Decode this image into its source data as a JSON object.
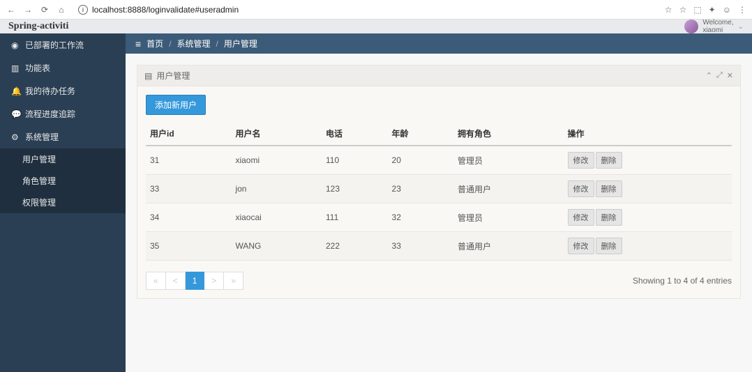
{
  "browser": {
    "url": "localhost:8888/loginvalidate#useradmin"
  },
  "header": {
    "brand": "Spring-activiti",
    "welcome": "Welcome,",
    "username": "xiaomi"
  },
  "sidebar": {
    "items": [
      {
        "icon": "dashboard",
        "label": "已部署的工作流"
      },
      {
        "icon": "chart",
        "label": "功能表"
      },
      {
        "icon": "bell",
        "label": "我的待办任务"
      },
      {
        "icon": "comment",
        "label": "流程进度追踪"
      },
      {
        "icon": "gear",
        "label": "系统管理",
        "sub": [
          {
            "label": "用户管理",
            "active": true
          },
          {
            "label": "角色管理"
          },
          {
            "label": "权限管理"
          }
        ]
      }
    ]
  },
  "breadcrumb": {
    "home": "首页",
    "system": "系统管理",
    "current": "用户管理"
  },
  "panel": {
    "title": "用户管理",
    "add_button": "添加新用户",
    "columns": [
      "用户id",
      "用户名",
      "电话",
      "年龄",
      "拥有角色",
      "操作"
    ],
    "rows": [
      {
        "id": "31",
        "name": "xiaomi",
        "phone": "110",
        "age": "20",
        "role": "管理员"
      },
      {
        "id": "33",
        "name": "jon",
        "phone": "123",
        "age": "23",
        "role": "普通用户"
      },
      {
        "id": "34",
        "name": "xiaocai",
        "phone": "111",
        "age": "32",
        "role": "管理员"
      },
      {
        "id": "35",
        "name": "WANG",
        "phone": "222",
        "age": "33",
        "role": "普通用户"
      }
    ],
    "actions": {
      "edit": "修改",
      "delete": "删除"
    },
    "pagination": {
      "first": "«",
      "prev": "<",
      "pages": [
        "1"
      ],
      "next": ">",
      "last": "»",
      "showing": "Showing 1 to 4 of 4 entries"
    }
  }
}
